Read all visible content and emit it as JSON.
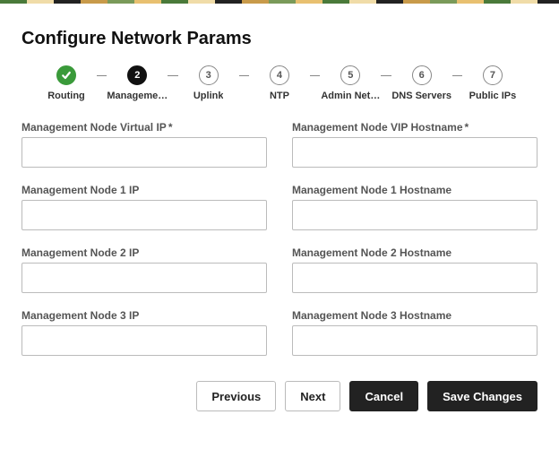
{
  "title": "Configure Network Params",
  "stepper": {
    "steps": [
      {
        "label": "Routing",
        "num": "1",
        "state": "done"
      },
      {
        "label": "Manageme…",
        "num": "2",
        "state": "active"
      },
      {
        "label": "Uplink",
        "num": "3",
        "state": "pending"
      },
      {
        "label": "NTP",
        "num": "4",
        "state": "pending"
      },
      {
        "label": "Admin Net…",
        "num": "5",
        "state": "pending"
      },
      {
        "label": "DNS Servers",
        "num": "6",
        "state": "pending"
      },
      {
        "label": "Public IPs",
        "num": "7",
        "state": "pending"
      }
    ]
  },
  "fields": {
    "virtual_ip": {
      "label": "Management Node Virtual IP",
      "required": true,
      "value": ""
    },
    "vip_hostname": {
      "label": "Management Node VIP Hostname",
      "required": true,
      "value": ""
    },
    "node1_ip": {
      "label": "Management Node 1 IP",
      "required": false,
      "value": ""
    },
    "node1_hostname": {
      "label": "Management Node 1 Hostname",
      "required": false,
      "value": ""
    },
    "node2_ip": {
      "label": "Management Node 2 IP",
      "required": false,
      "value": ""
    },
    "node2_hostname": {
      "label": "Management Node 2 Hostname",
      "required": false,
      "value": ""
    },
    "node3_ip": {
      "label": "Management Node 3 IP",
      "required": false,
      "value": ""
    },
    "node3_hostname": {
      "label": "Management Node 3 Hostname",
      "required": false,
      "value": ""
    }
  },
  "buttons": {
    "previous": "Previous",
    "next": "Next",
    "cancel": "Cancel",
    "save": "Save Changes"
  },
  "required_mark": "*"
}
